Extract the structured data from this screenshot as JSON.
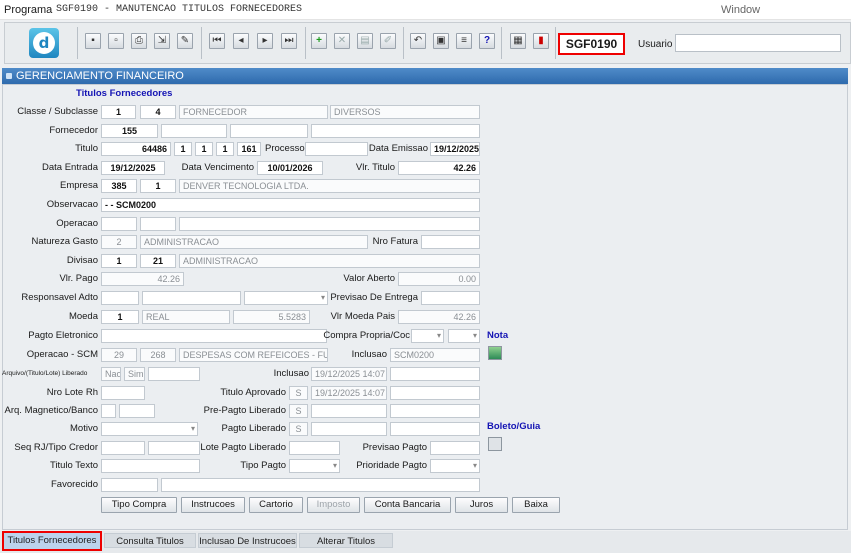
{
  "titlebar": {
    "menu": "Programa",
    "title": "SGF0190 - MANUTENCAO TITULOS FORNECEDORES",
    "window": "Window"
  },
  "toolbar": {
    "form_code": "SGF0190",
    "user_label": "Usuario",
    "user_value": ""
  },
  "panel": {
    "header": "GERENCIAMENTO FINANCEIRO",
    "section": "Titulos Fornecedores"
  },
  "labels": {
    "classe": "Classe / Subclasse",
    "fornecedor": "Fornecedor",
    "titulo": "Titulo",
    "processo": "Processo",
    "data_emissao": "Data Emissao",
    "data_entrada": "Data Entrada",
    "data_vencimento": "Data Vencimento",
    "vlr_titulo": "Vlr. Titulo",
    "empresa": "Empresa",
    "observacao": "Observacao",
    "operacao": "Operacao",
    "natureza_gasto": "Natureza Gasto",
    "nro_fatura": "Nro Fatura",
    "divisao": "Divisao",
    "vlr_pago": "Vlr. Pago",
    "valor_aberto": "Valor Aberto",
    "responsavel_adto": "Responsavel Adto",
    "previsao_entrega": "Previsao De Entrega",
    "moeda": "Moeda",
    "vlr_moeda_pais": "Vlr Moeda Pais",
    "pagto_eletronico": "Pagto Eletronico",
    "compra_propria": "Compra Propria/Coc",
    "nota": "Nota",
    "operacao_scm": "Operacao - SCM",
    "inclusao": "Inclusao",
    "arquivo": "Arquivo/(Titulo/Lote) Liberado",
    "inclusao2": "Inclusao",
    "nro_lote_rh": "Nro Lote Rh",
    "titulo_aprovado": "Titulo Aprovado",
    "arq_magnetico": "Arq. Magnetico/Banco",
    "pre_pagto": "Pre-Pagto Liberado",
    "motivo": "Motivo",
    "pagto_liberado": "Pagto Liberado",
    "boleto": "Boleto/Guia",
    "seq_rj": "Seq RJ/Tipo Credor",
    "lote_pagto": "Lote Pagto Liberado",
    "previsao_pagto": "Previsao Pagto",
    "titulo_texto": "Titulo Texto",
    "tipo_pagto": "Tipo Pagto",
    "prioridade_pagto": "Prioridade Pagto",
    "favorecido": "Favorecido"
  },
  "values": {
    "classe": "1",
    "subclasse": "4",
    "classe_desc": "FORNECEDOR",
    "subclasse_desc": "DIVERSOS",
    "fornecedor": "155",
    "titulo_num": "64486",
    "titulo_p1": "1",
    "titulo_p2": "1",
    "titulo_p3": "1",
    "titulo_p4": "161",
    "data_emissao": "19/12/2025",
    "data_entrada": "19/12/2025",
    "data_vencimento": "10/01/2026",
    "vlr_titulo": "42.26",
    "empresa": "385",
    "empresa_seq": "1",
    "empresa_nome": "DENVER TECNOLOGIA LTDA.",
    "observacao": "- - SCM0200",
    "natureza_cod": "2",
    "natureza_desc": "ADMINISTRACAO",
    "divisao": "1",
    "divisao_cod": "21",
    "divisao_desc": "ADMINISTRACAO",
    "vlr_pago": "42.26",
    "valor_aberto": "0.00",
    "moeda": "1",
    "moeda_desc": "REAL",
    "moeda_taxa": "5.5283",
    "vlr_moeda_pais": "42.26",
    "operacao_scm": "29",
    "operacao_scm_cod": "268",
    "operacao_scm_desc": "DESPESAS COM REFEICOES - FUN",
    "inclusao": "SCM0200",
    "arq_nao": "Nao",
    "arq_sim": "Sim",
    "inclusao_data": "19/12/2025 14:07",
    "titulo_aprovado_flag": "S",
    "titulo_aprovado_data": "19/12/2025 14:07",
    "pre_pagto_flag": "S",
    "pagto_liberado_flag": "S"
  },
  "buttons": [
    "Tipo Compra",
    "Instrucoes",
    "Cartorio",
    "Imposto",
    "Conta Bancaria",
    "Juros",
    "Baixa"
  ],
  "tabs": [
    "Titulos Fornecedores",
    "Consulta Titulos",
    "Inclusao De Instrucoes",
    "Alterar Titulos"
  ]
}
